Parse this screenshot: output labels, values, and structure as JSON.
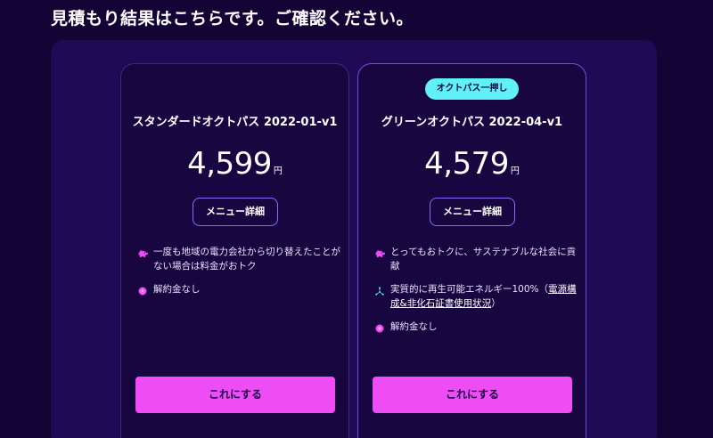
{
  "page": {
    "heading": "見積もり結果はこちらです。ご確認ください。"
  },
  "colors": {
    "background": "#140435",
    "panel": "#1f0a55",
    "card": "#170640",
    "cta": "#ee4df5",
    "badge": "#60f0f8",
    "outline": "#8d6bff"
  },
  "plans": [
    {
      "name": "スタンダードオクトパス 2022-01-v1",
      "price": "4,599",
      "unit": "円",
      "menu_label": "メニュー詳細",
      "features": [
        {
          "icon": "piggy-bank-icon",
          "text": "一度も地域の電力会社から切り替えたことがない場合は料金がおトク"
        },
        {
          "icon": "dot-icon",
          "text": "解約金なし"
        }
      ],
      "cta_label": "これにする"
    },
    {
      "badge": "オクトパス一押し",
      "name": "グリーンオクトパス 2022-04-v1",
      "price": "4,579",
      "unit": "円",
      "menu_label": "メニュー詳細",
      "features": [
        {
          "icon": "piggy-bank-icon",
          "text": "とってもおトクに、サステナブルな社会に貢献"
        },
        {
          "icon": "wind-turbine-icon",
          "text_prefix": "実質的に再生可能エネルギー100%（",
          "link": "電源構成&非化石証書使用状況",
          "text_suffix": "）"
        },
        {
          "icon": "dot-icon",
          "text": "解約金なし"
        }
      ],
      "cta_label": "これにする"
    }
  ]
}
